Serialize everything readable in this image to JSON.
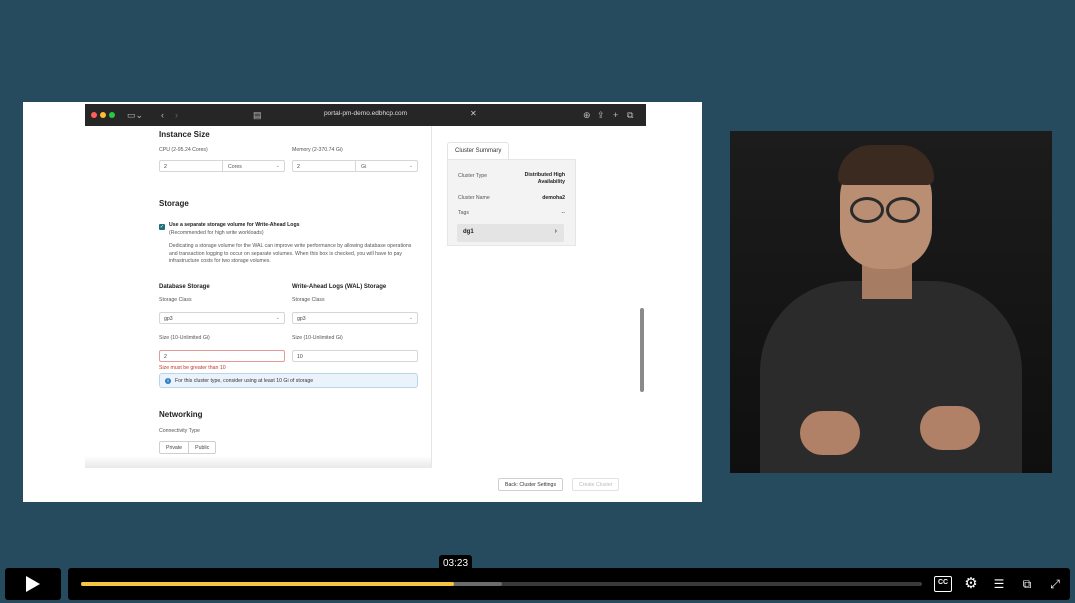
{
  "browser": {
    "url": "portal-pm-demo.edbhcp.com"
  },
  "form": {
    "instance_size": {
      "title": "Instance Size",
      "cpu_label": "CPU (2-95.24 Cores)",
      "cpu_value": "2",
      "cpu_unit": "Cores",
      "memory_label": "Memory (2-370.74 Gi)",
      "memory_value": "2",
      "memory_unit": "Gi"
    },
    "storage": {
      "title": "Storage",
      "checkbox_label": "Use a separate storage volume for Write-Ahead Logs",
      "checkbox_sub": "(Recommended for high write workloads)",
      "description": "Dedicating a storage volume for the WAL can improve write performance by allowing database operations and transaction logging to occur on separate volumes. When this box is checked, you will have to pay infrastructure costs for two storage volumes.",
      "db_storage_title": "Database Storage",
      "wal_storage_title": "Write-Ahead Logs (WAL) Storage",
      "storage_class_label": "Storage Class",
      "db_storage_class": "gp3",
      "wal_storage_class": "gp3",
      "size_label": "Size (10-Unlimited Gi)",
      "db_size_value": "2",
      "wal_size_value": "10",
      "error_text": "Size must be greater than 10",
      "info_text": "For this cluster type, consider using at least 10 Gi of storage"
    },
    "networking": {
      "title": "Networking",
      "connectivity_label": "Connectivity Type",
      "private_label": "Private",
      "public_label": "Public"
    }
  },
  "summary": {
    "tab": "Cluster Summary",
    "cluster_type_key": "Cluster Type",
    "cluster_type_value_line1": "Distributed High",
    "cluster_type_value_line2": "Availability",
    "cluster_name_key": "Cluster Name",
    "cluster_name_value": "demoha2",
    "tags_key": "Tags",
    "tags_value": "--",
    "group_name": "dg1"
  },
  "footer": {
    "back_label": "Back: Cluster Settings",
    "create_label": "Create Cluster"
  },
  "player": {
    "time_tooltip": "03:23",
    "progress": 0.444,
    "buffered": 0.5,
    "cc_label": "CC",
    "colors": {
      "progress": "#f5c542",
      "background": "#264a5e"
    }
  }
}
